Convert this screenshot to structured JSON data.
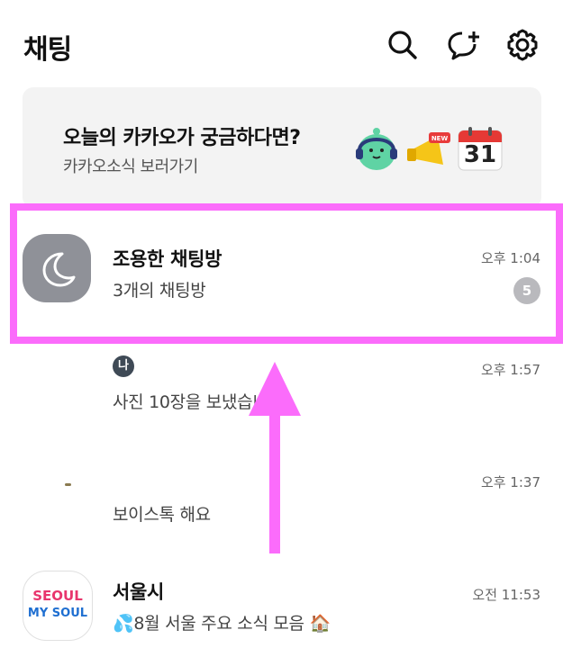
{
  "header": {
    "title": "채팅",
    "icons": [
      "search-icon",
      "new-chat-icon",
      "settings-icon"
    ]
  },
  "banner": {
    "title": "오늘의 카카오가 궁금하다면?",
    "subtitle": "카카오소식 보러가기",
    "calendar_day": "31",
    "new_label": "NEW"
  },
  "chats": [
    {
      "name": "조용한 채팅방",
      "message": "3개의 채팅방",
      "time": "오후 1:04",
      "unread": "5"
    },
    {
      "name": "",
      "me_label": "나",
      "message": "사진 10장을 보냈습니다.",
      "time": "오후 1:57"
    },
    {
      "name": "",
      "message": "보이스톡 해요",
      "time": "오후 1:37"
    },
    {
      "name": "서울시",
      "message": "💦8월 서울 주요 소식 모음 🏠",
      "time": "오전 11:53",
      "avatar_lines": [
        "SEOUL",
        "MY SOUL"
      ]
    }
  ],
  "colors": {
    "highlight": "#fb6cfb",
    "badge": "#b9b9bd",
    "banner_bg": "#f3f3f3"
  }
}
